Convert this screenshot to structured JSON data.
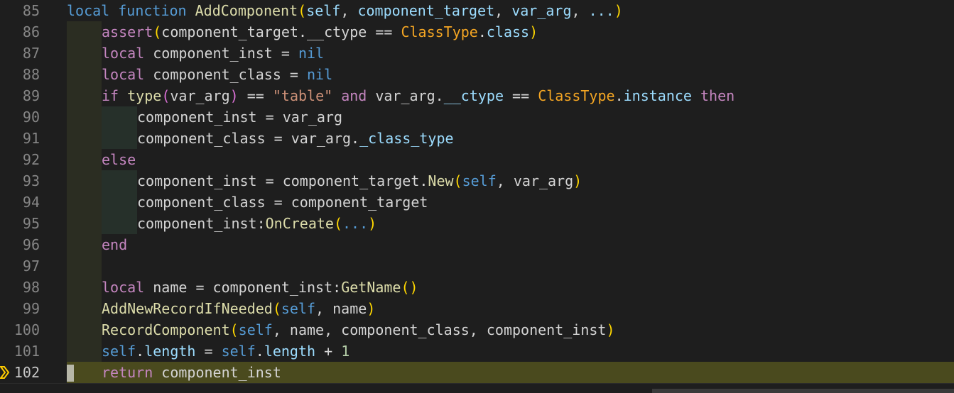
{
  "editor": {
    "lines": [
      {
        "num": "85",
        "tokens": [
          {
            "t": "local",
            "c": "kwb"
          },
          {
            "t": " ",
            "c": "var"
          },
          {
            "t": "function",
            "c": "kwb"
          },
          {
            "t": " ",
            "c": "var"
          },
          {
            "t": "AddComponent",
            "c": "fn"
          },
          {
            "t": "(",
            "c": "br1"
          },
          {
            "t": "self",
            "c": "param"
          },
          {
            "t": ", ",
            "c": "op"
          },
          {
            "t": "component_target",
            "c": "param"
          },
          {
            "t": ", ",
            "c": "op"
          },
          {
            "t": "var_arg",
            "c": "param"
          },
          {
            "t": ", ",
            "c": "op"
          },
          {
            "t": "...",
            "c": "param"
          },
          {
            "t": ")",
            "c": "br1"
          }
        ]
      },
      {
        "num": "86",
        "tokens": [
          {
            "t": "assert",
            "c": "kw"
          },
          {
            "t": "(",
            "c": "br1"
          },
          {
            "t": "component_target",
            "c": "var"
          },
          {
            "t": ".",
            "c": "op"
          },
          {
            "t": "__ctype",
            "c": "var"
          },
          {
            "t": " == ",
            "c": "op"
          },
          {
            "t": "ClassType",
            "c": "sclass"
          },
          {
            "t": ".",
            "c": "op"
          },
          {
            "t": "class",
            "c": "prop"
          },
          {
            "t": ")",
            "c": "br1"
          }
        ]
      },
      {
        "num": "87",
        "tokens": [
          {
            "t": "local",
            "c": "kw"
          },
          {
            "t": " component_inst ",
            "c": "var"
          },
          {
            "t": "=",
            "c": "op"
          },
          {
            "t": " ",
            "c": "var"
          },
          {
            "t": "nil",
            "c": "kwb"
          }
        ]
      },
      {
        "num": "88",
        "tokens": [
          {
            "t": "local",
            "c": "kw"
          },
          {
            "t": " component_class ",
            "c": "var"
          },
          {
            "t": "=",
            "c": "op"
          },
          {
            "t": " ",
            "c": "var"
          },
          {
            "t": "nil",
            "c": "kwb"
          }
        ]
      },
      {
        "num": "89",
        "tokens": [
          {
            "t": "if",
            "c": "kw"
          },
          {
            "t": " ",
            "c": "var"
          },
          {
            "t": "type",
            "c": "fn"
          },
          {
            "t": "(",
            "c": "br2"
          },
          {
            "t": "var_arg",
            "c": "var"
          },
          {
            "t": ")",
            "c": "br2"
          },
          {
            "t": " == ",
            "c": "op"
          },
          {
            "t": "\"table\"",
            "c": "str"
          },
          {
            "t": " ",
            "c": "var"
          },
          {
            "t": "and",
            "c": "kw"
          },
          {
            "t": " var_arg",
            "c": "var"
          },
          {
            "t": ".",
            "c": "op"
          },
          {
            "t": "__ctype",
            "c": "prop"
          },
          {
            "t": " == ",
            "c": "op"
          },
          {
            "t": "ClassType",
            "c": "sclass"
          },
          {
            "t": ".",
            "c": "op"
          },
          {
            "t": "instance",
            "c": "prop"
          },
          {
            "t": " ",
            "c": "var"
          },
          {
            "t": "then",
            "c": "kw"
          }
        ]
      },
      {
        "num": "90",
        "tokens": [
          {
            "t": "component_inst ",
            "c": "var"
          },
          {
            "t": "=",
            "c": "op"
          },
          {
            "t": " var_arg",
            "c": "var"
          }
        ]
      },
      {
        "num": "91",
        "tokens": [
          {
            "t": "component_class ",
            "c": "var"
          },
          {
            "t": "=",
            "c": "op"
          },
          {
            "t": " var_arg",
            "c": "var"
          },
          {
            "t": ".",
            "c": "op"
          },
          {
            "t": "_class_type",
            "c": "prop"
          }
        ]
      },
      {
        "num": "92",
        "tokens": [
          {
            "t": "else",
            "c": "kw"
          }
        ]
      },
      {
        "num": "93",
        "tokens": [
          {
            "t": "component_inst ",
            "c": "var"
          },
          {
            "t": "=",
            "c": "op"
          },
          {
            "t": " component_target",
            "c": "var"
          },
          {
            "t": ".",
            "c": "op"
          },
          {
            "t": "New",
            "c": "fn"
          },
          {
            "t": "(",
            "c": "br1"
          },
          {
            "t": "self",
            "c": "self"
          },
          {
            "t": ", ",
            "c": "op"
          },
          {
            "t": "var_arg",
            "c": "var"
          },
          {
            "t": ")",
            "c": "br1"
          }
        ]
      },
      {
        "num": "94",
        "tokens": [
          {
            "t": "component_class ",
            "c": "var"
          },
          {
            "t": "=",
            "c": "op"
          },
          {
            "t": " component_target",
            "c": "var"
          }
        ]
      },
      {
        "num": "95",
        "tokens": [
          {
            "t": "component_inst",
            "c": "var"
          },
          {
            "t": ":",
            "c": "op"
          },
          {
            "t": "OnCreate",
            "c": "fn"
          },
          {
            "t": "(",
            "c": "br1"
          },
          {
            "t": "...",
            "c": "ell"
          },
          {
            "t": ")",
            "c": "br1"
          }
        ]
      },
      {
        "num": "96",
        "tokens": [
          {
            "t": "end",
            "c": "kw"
          }
        ]
      },
      {
        "num": "97",
        "tokens": []
      },
      {
        "num": "98",
        "tokens": [
          {
            "t": "local",
            "c": "kw"
          },
          {
            "t": " name ",
            "c": "var"
          },
          {
            "t": "=",
            "c": "op"
          },
          {
            "t": " component_inst",
            "c": "var"
          },
          {
            "t": ":",
            "c": "op"
          },
          {
            "t": "GetName",
            "c": "fn"
          },
          {
            "t": "()",
            "c": "br1"
          }
        ]
      },
      {
        "num": "99",
        "tokens": [
          {
            "t": "AddNewRecordIfNeeded",
            "c": "fn"
          },
          {
            "t": "(",
            "c": "br1"
          },
          {
            "t": "self",
            "c": "self"
          },
          {
            "t": ", ",
            "c": "op"
          },
          {
            "t": "name",
            "c": "var"
          },
          {
            "t": ")",
            "c": "br1"
          }
        ]
      },
      {
        "num": "100",
        "tokens": [
          {
            "t": "RecordComponent",
            "c": "fn"
          },
          {
            "t": "(",
            "c": "br1"
          },
          {
            "t": "self",
            "c": "self"
          },
          {
            "t": ", name, component_class, component_inst",
            "c": "var"
          },
          {
            "t": ")",
            "c": "br1"
          }
        ]
      },
      {
        "num": "101",
        "tokens": [
          {
            "t": "self",
            "c": "self"
          },
          {
            "t": ".",
            "c": "op"
          },
          {
            "t": "length",
            "c": "prop"
          },
          {
            "t": " = ",
            "c": "op"
          },
          {
            "t": "self",
            "c": "self"
          },
          {
            "t": ".",
            "c": "op"
          },
          {
            "t": "length",
            "c": "prop"
          },
          {
            "t": " + ",
            "c": "op"
          },
          {
            "t": "1",
            "c": "num"
          }
        ]
      },
      {
        "num": "102",
        "tokens": [
          {
            "t": "return",
            "c": "kw"
          },
          {
            "t": " component_inst",
            "c": "var"
          }
        ]
      }
    ]
  }
}
